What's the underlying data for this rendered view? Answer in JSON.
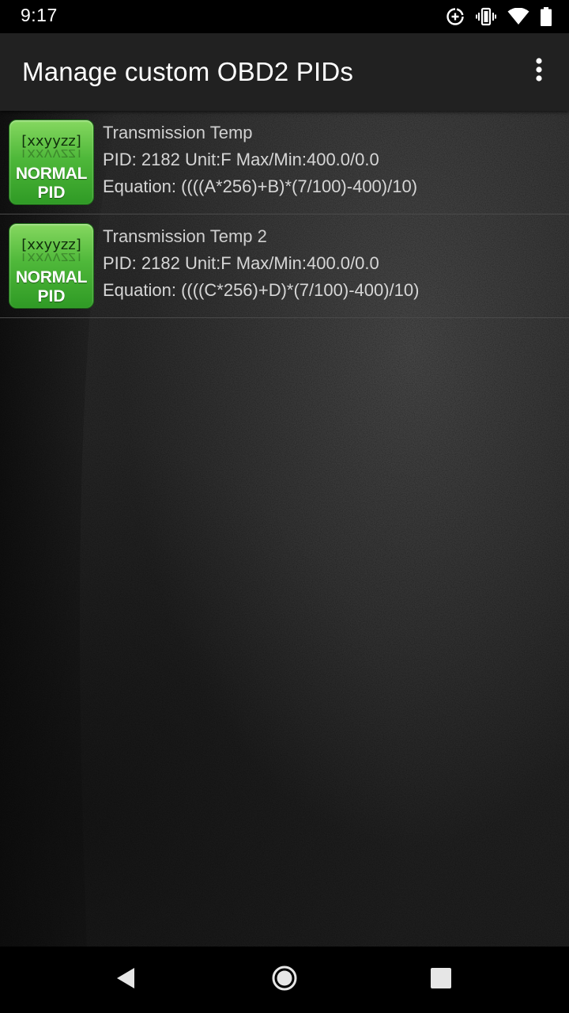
{
  "status_bar": {
    "time": "9:17"
  },
  "app_bar": {
    "title": "Manage custom OBD2 PIDs"
  },
  "badge": {
    "code": "[xxyyzz]",
    "line1": "NORMAL",
    "line2": "PID"
  },
  "pids": [
    {
      "name": "Transmission Temp",
      "meta": "PID: 2182  Unit:F Max/Min:400.0/0.0",
      "equation": "Equation: ((((A*256)+B)*(7/100)-400)/10)"
    },
    {
      "name": "Transmission Temp 2",
      "meta": "PID: 2182  Unit:F Max/Min:400.0/0.0",
      "equation": "Equation: ((((C*256)+D)*(7/100)-400)/10)"
    }
  ],
  "icons": {
    "status": [
      "data-saver-icon",
      "vibrate-icon",
      "wifi-icon",
      "battery-icon"
    ],
    "overflow": "more-vert-icon",
    "nav": [
      "back-icon",
      "home-icon",
      "recents-icon"
    ]
  },
  "colors": {
    "app_bar": "#212121",
    "badge_green": "#4fb83a",
    "text": "#d6d6d6"
  }
}
